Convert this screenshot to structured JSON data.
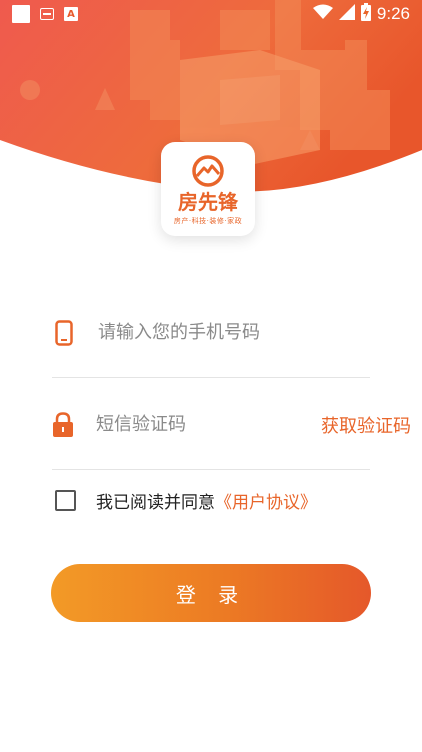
{
  "status_bar": {
    "time": "9:26",
    "icons": [
      "notification-square-icon",
      "message-icon",
      "a-app-icon",
      "wifi-icon",
      "signal-icon",
      "battery-charging-icon"
    ]
  },
  "brand": {
    "name": "房先锋",
    "tagline": "房产·科技·装修·家政",
    "accent_color": "#e8652a"
  },
  "form": {
    "phone_placeholder": "请输入您的手机号码",
    "phone_value": "",
    "code_placeholder": "短信验证码",
    "code_value": "",
    "get_code_label": "获取验证码"
  },
  "agreement": {
    "checked": false,
    "text": "我已阅读并同意",
    "link_label": "《用户协议》"
  },
  "login_label": "登 录"
}
